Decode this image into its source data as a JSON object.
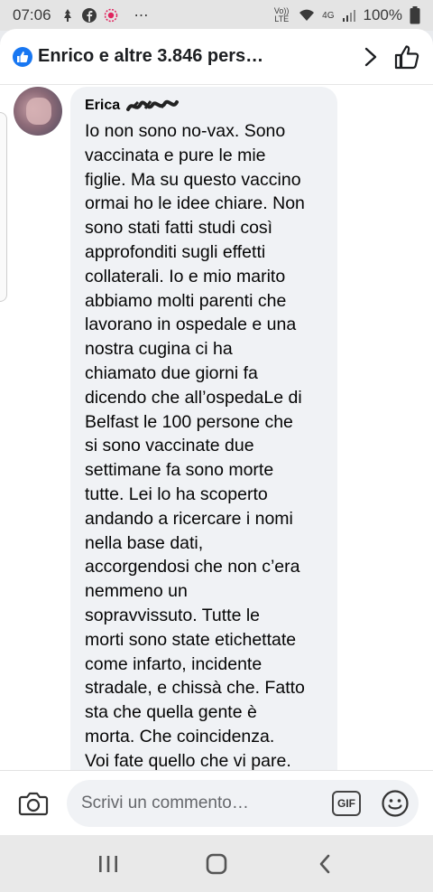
{
  "status_bar": {
    "time": "07:06",
    "network": "Vo)) LTE",
    "signal": "4G",
    "battery": "100%",
    "more": "⋯"
  },
  "reactions": {
    "text": "Enrico e altre 3.846 pers…",
    "like_color": "#1877f2"
  },
  "comment": {
    "author": "Erica",
    "lines": [
      "Io non sono no-vax. Sono",
      "vaccinata e pure le mie",
      "figlie. Ma su questo vaccino",
      "ormai ho le idee chiare. Non",
      "sono stati fatti studi così",
      "approfonditi sugli effetti",
      "collaterali. Io e mio marito",
      "abbiamo molti parenti che",
      "lavorano in ospedale e una",
      "nostra cugina ci ha",
      "chiamato due giorni fa",
      "dicendo che all’ospedaLe di",
      "Belfast le 100 persone che",
      "si sono vaccinate due",
      "settimane fa sono morte",
      "tutte. Lei lo ha scoperto",
      "andando a ricercare i nomi",
      "nella base dati,",
      "accorgendosi che non c’era",
      "nemmeno un",
      "sopravvissuto. Tutte le",
      "morti sono state etichettate",
      "come infarto, incidente",
      "stradale, e chissà che. Fatto",
      "sta che quella gente è",
      "morta. Che coincidenza.",
      "Voi fate quello che vi pare."
    ]
  },
  "composer": {
    "placeholder": "Scrivi un commento…",
    "gif_label": "GIF"
  },
  "nav": {
    "recents_icon": "recents-icon",
    "home_icon": "home-icon",
    "back_icon": "back-icon"
  }
}
